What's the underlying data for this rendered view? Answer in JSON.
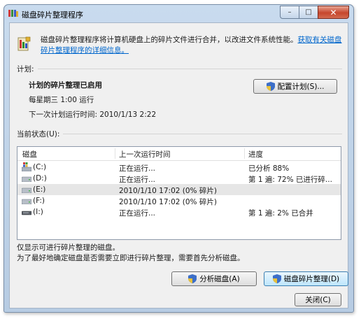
{
  "window": {
    "title": "磁盘碎片整理程序",
    "caption": {
      "minimize": "–",
      "maximize": "□",
      "close": "✕"
    }
  },
  "intro": {
    "text": "磁盘碎片整理程序将计算机硬盘上的碎片文件进行合并，以改进文件系统性能。",
    "link": "获取有关磁盘碎片整理程序的详细信息。"
  },
  "schedule": {
    "section_label": "计划:",
    "status": "计划的碎片整理已启用",
    "frequency": "每星期三 1:00 运行",
    "next_run": "下一次计划运行时间: 2010/1/13 2:22",
    "configure_button": "配置计划(S)..."
  },
  "current_status": {
    "section_label": "当前状态(U):",
    "columns": [
      "磁盘",
      "上一次运行时间",
      "进度"
    ],
    "rows": [
      {
        "disk": "(C:)",
        "last_run": "正在运行...",
        "progress": "已分析 88%",
        "icon": "system-drive-icon"
      },
      {
        "disk": "(D:)",
        "last_run": "正在运行...",
        "progress": "第 1 遍: 72% 已进行碎...",
        "icon": "drive-icon"
      },
      {
        "disk": "(E:)",
        "last_run": "2010/1/10 17:02 (0% 碎片)",
        "progress": "",
        "icon": "drive-icon"
      },
      {
        "disk": "(F:)",
        "last_run": "2010/1/10 17:02 (0% 碎片)",
        "progress": "",
        "icon": "drive-icon"
      },
      {
        "disk": "(I:)",
        "last_run": "正在运行...",
        "progress": "第 1 遍: 2% 已合并",
        "icon": "removable-drive-icon"
      }
    ]
  },
  "notes": {
    "line1": "仅显示可进行碎片整理的磁盘。",
    "line2": "为了最好地确定磁盘是否需要立即进行碎片整理，需要首先分析磁盘。"
  },
  "buttons": {
    "analyze": "分析磁盘(A)",
    "defrag": "磁盘碎片整理(D)",
    "close": "关闭(C)"
  },
  "colors": {
    "link": "#0066cc",
    "close_button": "#c6462c",
    "selected_row": "#e6e6e6"
  }
}
